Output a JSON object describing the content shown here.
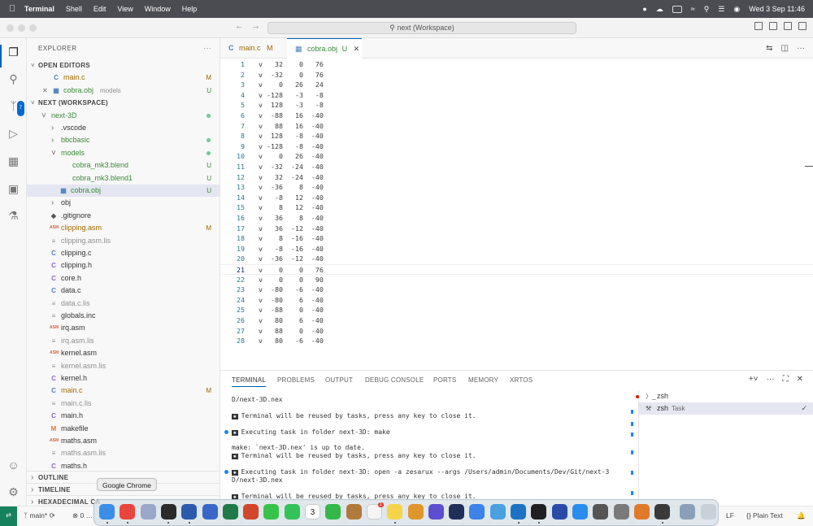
{
  "menubar": {
    "app_name": "Terminal",
    "items": [
      "Shell",
      "Edit",
      "View",
      "Window",
      "Help"
    ],
    "clock": "Wed 3 Sep  11:46"
  },
  "titlebar": {
    "command_center": "next (Workspace)"
  },
  "activity_bar": {
    "source_control_badge": "7",
    "icons": [
      "files-icon",
      "search-icon",
      "source-control-icon",
      "run-debug-icon",
      "extensions-icon",
      "remote-explorer-icon",
      "testing-icon",
      "account-icon",
      "settings-gear-icon"
    ]
  },
  "sidebar": {
    "header": "EXPLORER",
    "open_editors_title": "OPEN EDITORS",
    "open_editors": [
      {
        "name": "main.c",
        "status": "M"
      },
      {
        "name": "cobra.obj",
        "detail": "models",
        "status": "U"
      }
    ],
    "workspace_title": "NEXT (WORKSPACE)",
    "tree": [
      {
        "name": "next-3D",
        "indent": 1,
        "kind": "folder-open",
        "color": "green",
        "dot": true
      },
      {
        "name": ".vscode",
        "indent": 2,
        "kind": "folder",
        "color": "normal"
      },
      {
        "name": "bbcbasic",
        "indent": 2,
        "kind": "folder",
        "color": "green",
        "dot": true
      },
      {
        "name": "models",
        "indent": 2,
        "kind": "folder-open",
        "color": "green",
        "dot": true
      },
      {
        "name": "cobra_mk3.blend",
        "indent": 3,
        "kind": "file",
        "color": "green",
        "status": "U"
      },
      {
        "name": "cobra_mk3.blend1",
        "indent": 3,
        "kind": "file",
        "color": "green",
        "status": "U"
      },
      {
        "name": "cobra.obj",
        "indent": 3,
        "kind": "obj",
        "color": "green",
        "status": "U",
        "selected": true
      },
      {
        "name": "obj",
        "indent": 2,
        "kind": "folder",
        "color": "normal"
      },
      {
        "name": ".gitignore",
        "indent": 2,
        "kind": "git",
        "color": "normal"
      },
      {
        "name": "clipping.asm",
        "indent": 2,
        "kind": "asm",
        "color": "amber",
        "status": "M"
      },
      {
        "name": "clipping.asm.lis",
        "indent": 2,
        "kind": "plain",
        "color": "grey"
      },
      {
        "name": "clipping.c",
        "indent": 2,
        "kind": "c",
        "color": "normal"
      },
      {
        "name": "clipping.h",
        "indent": 2,
        "kind": "h",
        "color": "normal"
      },
      {
        "name": "core.h",
        "indent": 2,
        "kind": "h",
        "color": "normal"
      },
      {
        "name": "data.c",
        "indent": 2,
        "kind": "c",
        "color": "normal"
      },
      {
        "name": "data.c.lis",
        "indent": 2,
        "kind": "plain",
        "color": "grey"
      },
      {
        "name": "globals.inc",
        "indent": 2,
        "kind": "plain",
        "color": "normal"
      },
      {
        "name": "irq.asm",
        "indent": 2,
        "kind": "asm",
        "color": "normal"
      },
      {
        "name": "irq.asm.lis",
        "indent": 2,
        "kind": "plain",
        "color": "grey"
      },
      {
        "name": "kernel.asm",
        "indent": 2,
        "kind": "asm",
        "color": "normal"
      },
      {
        "name": "kernel.asm.lis",
        "indent": 2,
        "kind": "plain",
        "color": "grey"
      },
      {
        "name": "kernel.h",
        "indent": 2,
        "kind": "h",
        "color": "normal"
      },
      {
        "name": "main.c",
        "indent": 2,
        "kind": "c",
        "color": "amber",
        "status": "M"
      },
      {
        "name": "main.c.lis",
        "indent": 2,
        "kind": "plain",
        "color": "grey"
      },
      {
        "name": "main.h",
        "indent": 2,
        "kind": "h",
        "color": "normal"
      },
      {
        "name": "makefile",
        "indent": 2,
        "kind": "make",
        "color": "normal"
      },
      {
        "name": "maths.asm",
        "indent": 2,
        "kind": "asm",
        "color": "normal"
      },
      {
        "name": "maths.asm.lis",
        "indent": 2,
        "kind": "plain",
        "color": "grey"
      },
      {
        "name": "maths.h",
        "indent": 2,
        "kind": "h",
        "color": "normal"
      }
    ],
    "bottom_sections": [
      "OUTLINE",
      "TIMELINE",
      "HEXADECIMAL CA"
    ]
  },
  "editor": {
    "tabs": [
      {
        "name": "main.c",
        "status": "M",
        "active": false
      },
      {
        "name": "cobra.obj",
        "status": "U",
        "active": true
      }
    ],
    "current_line": 21,
    "lines": [
      "v   32    0   76",
      "v  -32    0   76",
      "v    0   26   24",
      "v -128   -3   -8",
      "v  128   -3   -8",
      "v  -88   16  -40",
      "v   88   16  -40",
      "v  128   -8  -40",
      "v -128   -8  -40",
      "v    0   26  -40",
      "v  -32  -24  -40",
      "v   32  -24  -40",
      "v  -36    8  -40",
      "v   -8   12  -40",
      "v    8   12  -40",
      "v   36    8  -40",
      "v   36  -12  -40",
      "v    8  -16  -40",
      "v   -8  -16  -40",
      "v  -36  -12  -40",
      "v    0    0   76",
      "v    0    0   90",
      "v  -80   -6  -40",
      "v  -80    6  -40",
      "v  -88    0  -40",
      "v   80    6  -40",
      "v   88    0  -40",
      "v   80   -6  -40"
    ]
  },
  "panel": {
    "tabs": [
      "TERMINAL",
      "PROBLEMS",
      "OUTPUT",
      "DEBUG CONSOLE",
      "PORTS",
      "MEMORY",
      "XRTOS"
    ],
    "terminal_lines": [
      {
        "text": "D/next-3D.nex",
        "star": false,
        "dot": false
      },
      {
        "text": "",
        "star": false,
        "dot": false
      },
      {
        "text": "Terminal will be reused by tasks, press any key to close it.",
        "star": true,
        "dot": false
      },
      {
        "text": "",
        "star": false,
        "dot": false
      },
      {
        "text": "Executing task in folder next-3D: make",
        "star": true,
        "dot": true
      },
      {
        "text": "",
        "star": false,
        "dot": false
      },
      {
        "text": "make: `next-3D.nex' is up to date.",
        "star": false,
        "dot": false
      },
      {
        "text": "Terminal will be reused by tasks, press any key to close it.",
        "star": true,
        "dot": false
      },
      {
        "text": "",
        "star": false,
        "dot": false
      },
      {
        "text": "Executing task in folder next-3D: open -a zesarux --args /Users/admin/Documents/Dev/Git/next-3",
        "star": true,
        "dot": true
      },
      {
        "text": "D/next-3D.nex",
        "star": false,
        "dot": false
      },
      {
        "text": "",
        "star": false,
        "dot": false
      },
      {
        "text": "Terminal will be reused by tasks, press any key to close it.",
        "star": true,
        "dot": false
      }
    ],
    "terminals": [
      {
        "name": "zsh",
        "task": "",
        "selected": false
      },
      {
        "name": "zsh",
        "task": "Task",
        "selected": true
      }
    ]
  },
  "statusbar": {
    "branch": "main*",
    "problems": "0",
    "warnings": "0 …",
    "line_ending": "LF",
    "language": "Plain Text"
  },
  "dock": {
    "tooltip": "Google Chrome",
    "calendar_day": "3",
    "reminders_badge": "1",
    "apps": [
      {
        "name": "finder",
        "color": "#3a8ee6"
      },
      {
        "name": "google-chrome",
        "color": "#e8453c"
      },
      {
        "name": "launchpad",
        "color": "#9aa7c9"
      },
      {
        "name": "terminal",
        "color": "#2b2b2b"
      },
      {
        "name": "word",
        "color": "#2b5aad"
      },
      {
        "name": "security",
        "color": "#3867c8"
      },
      {
        "name": "excel",
        "color": "#1f7a45"
      },
      {
        "name": "powerpoint",
        "color": "#d0472b"
      },
      {
        "name": "messages",
        "color": "#39c24a"
      },
      {
        "name": "whatsapp",
        "color": "#36c25a"
      },
      {
        "name": "calendar",
        "color": "#ffffff"
      },
      {
        "name": "facetime",
        "color": "#35b84a"
      },
      {
        "name": "archive",
        "color": "#b07a3c"
      },
      {
        "name": "reminders",
        "color": "#f4f4f4"
      },
      {
        "name": "notes",
        "color": "#f6d44a"
      },
      {
        "name": "headphones",
        "color": "#e0962b"
      },
      {
        "name": "imovie",
        "color": "#5b4fd1"
      },
      {
        "name": "davinci",
        "color": "#222e5a"
      },
      {
        "name": "safari",
        "color": "#3c82e8"
      },
      {
        "name": "freeform",
        "color": "#4aa0e0"
      },
      {
        "name": "vscode",
        "color": "#1e72c4"
      },
      {
        "name": "zesarux",
        "color": "#202020"
      },
      {
        "name": "kicad",
        "color": "#2a4aa8"
      },
      {
        "name": "app-store",
        "color": "#2b8cf0"
      },
      {
        "name": "screenshot",
        "color": "#555555"
      },
      {
        "name": "system-settings",
        "color": "#7a7a7a"
      },
      {
        "name": "pencil",
        "color": "#e07a2b"
      },
      {
        "name": "blender",
        "color": "#3a3a3a"
      },
      {
        "name": "downloads",
        "color": "#8aa0b8"
      },
      {
        "name": "trash",
        "color": "#c9d1d8"
      }
    ]
  }
}
